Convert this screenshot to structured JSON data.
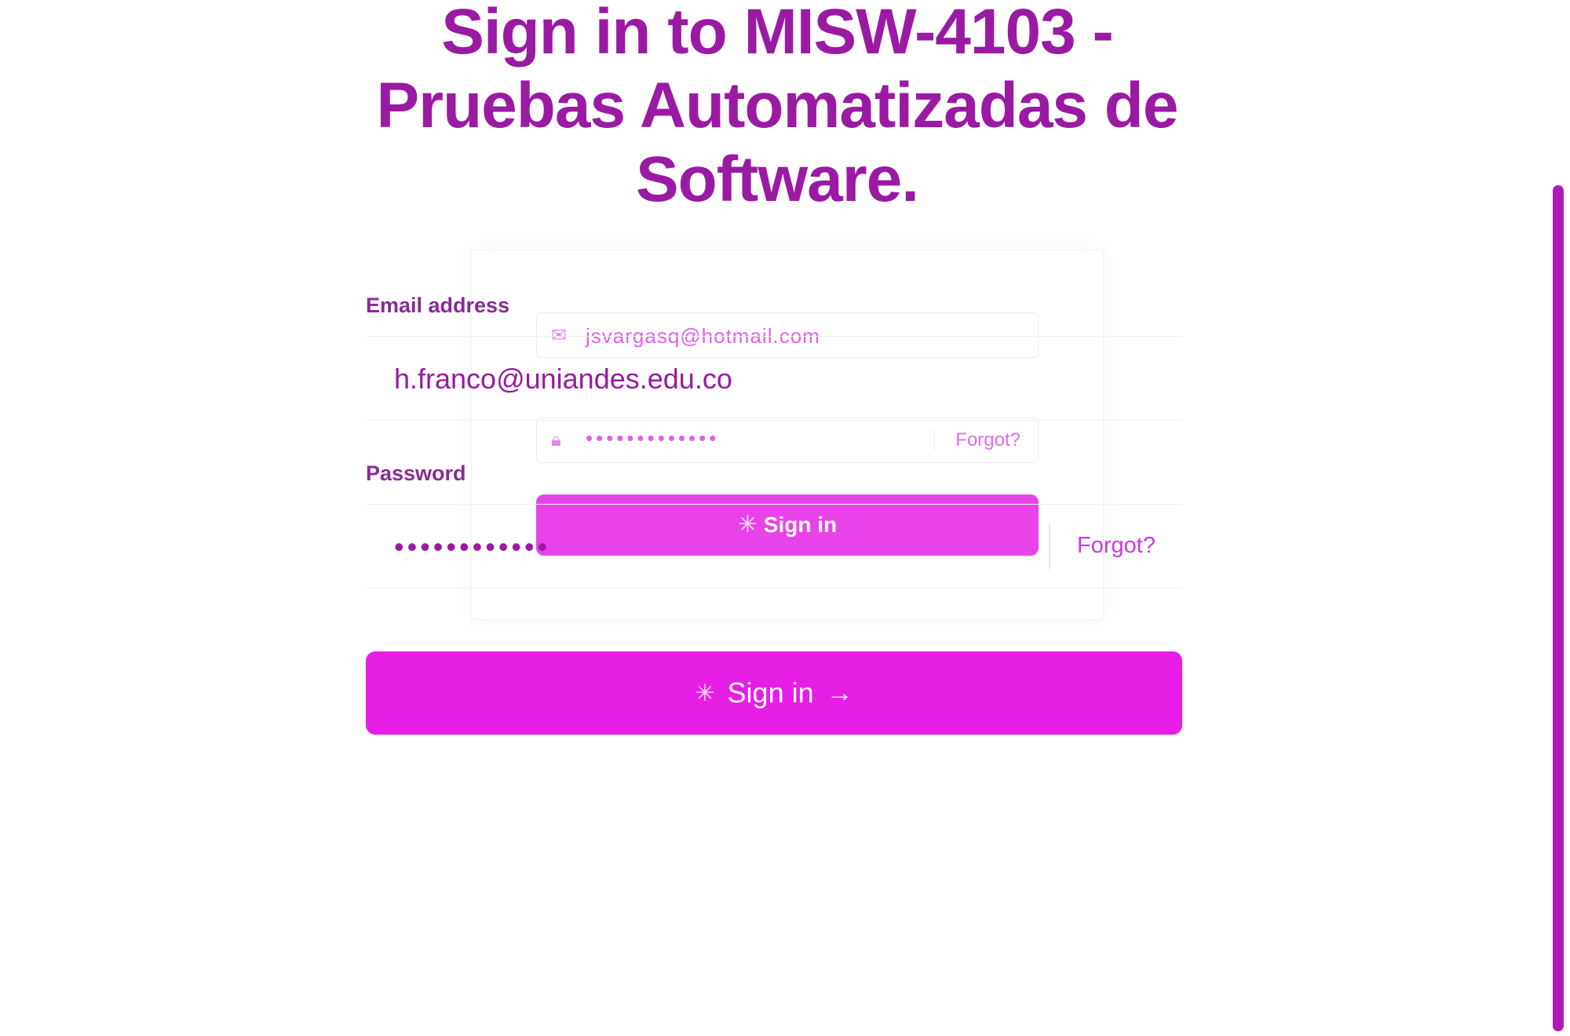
{
  "header": {
    "title_lines": [
      "Sign in to MISW-4103 -",
      "Pruebas Automatizadas de",
      "Software."
    ]
  },
  "ghost_form": {
    "email_value": "jsvargasq@hotmail.com",
    "password_mask": "•••••••••••••",
    "forgot_label": "Forgot?",
    "button_label": "Sign in",
    "email_icon": "mail-icon",
    "lock_icon": "lock-icon"
  },
  "form": {
    "email_label": "Email address",
    "email_value": "h.franco@uniandes.edu.co",
    "password_label": "Password",
    "password_value": "••••••••••••",
    "forgot_label": "Forgot?",
    "signin_label": "Sign in",
    "signin_arrow": "→",
    "spinner_icon": "spinner-icon"
  },
  "colors": {
    "accent": "#e61ee6",
    "title": "#9a1aa4",
    "link": "#cf39d9"
  }
}
